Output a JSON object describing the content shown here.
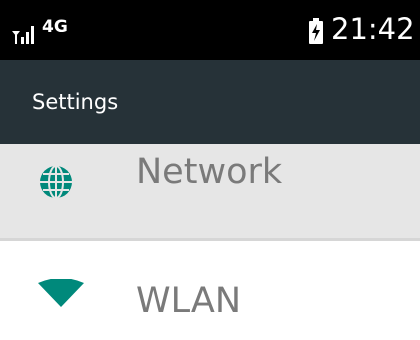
{
  "status_bar": {
    "network_type": "4G",
    "time": "21:42",
    "icons": [
      "signal-icon",
      "battery-charging-icon"
    ]
  },
  "header": {
    "title": "Settings"
  },
  "colors": {
    "status_bar_bg": "#000000",
    "header_bg": "#263238",
    "accent": "#00897b",
    "selected_row_bg": "#e6e6e6",
    "label_text": "#7a7a7a"
  },
  "settings_list": {
    "items": [
      {
        "label": "Network",
        "icon": "globe-icon",
        "selected": true
      },
      {
        "label": "WLAN",
        "icon": "wifi-icon",
        "selected": false
      }
    ]
  }
}
